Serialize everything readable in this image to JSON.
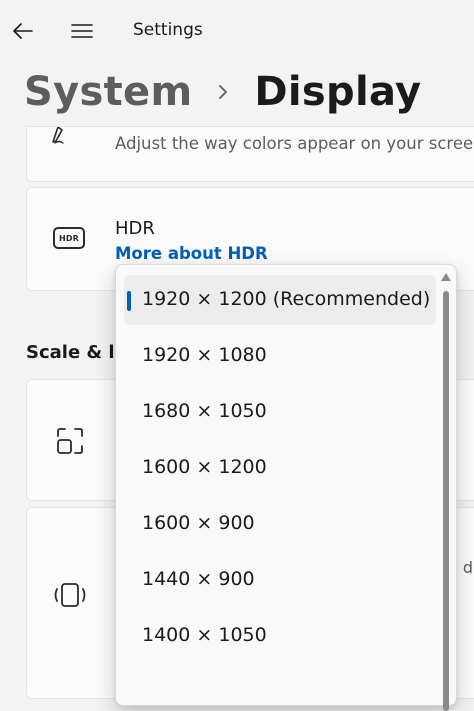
{
  "window": {
    "title": "Settings"
  },
  "titlebar": {
    "back_icon": "back-arrow-icon",
    "menu_icon": "hamburger-menu-icon"
  },
  "breadcrumb": {
    "parent": "System",
    "separator_icon": "chevron-right-icon",
    "current": "Display"
  },
  "color_card": {
    "description": "Adjust the way colors appear on your screen",
    "icon": "pen-icon"
  },
  "hdr_card": {
    "icon": "hdr-icon",
    "icon_text": "HDR",
    "title": "HDR",
    "link": "More about HDR"
  },
  "section": {
    "scale_layout_label": "Scale & la"
  },
  "orientation_card": {
    "side_text": "d d"
  },
  "resolution_dropdown": {
    "selected_index": 0,
    "accent_color": "#005fb8",
    "options": [
      {
        "label": "1920 × 1200 (Recommended)"
      },
      {
        "label": "1920 × 1080"
      },
      {
        "label": "1680 × 1050"
      },
      {
        "label": "1600 × 1200"
      },
      {
        "label": "1600 × 900"
      },
      {
        "label": "1440 × 900"
      },
      {
        "label": "1400 × 1050"
      }
    ]
  }
}
